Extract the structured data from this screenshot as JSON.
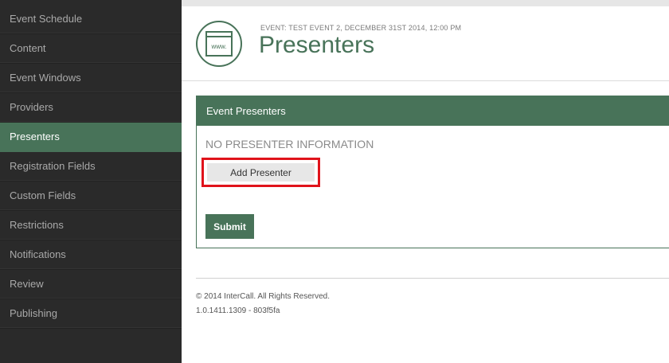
{
  "sidebar": {
    "items": [
      {
        "label": "Event Schedule"
      },
      {
        "label": "Content"
      },
      {
        "label": "Event Windows"
      },
      {
        "label": "Providers"
      },
      {
        "label": "Presenters",
        "active": true
      },
      {
        "label": "Registration Fields"
      },
      {
        "label": "Custom Fields"
      },
      {
        "label": "Restrictions"
      },
      {
        "label": "Notifications"
      },
      {
        "label": "Review"
      },
      {
        "label": "Publishing"
      }
    ]
  },
  "header": {
    "icon": "browser-window-icon",
    "icon_text": "www.",
    "event_line": "EVENT: TEST EVENT 2, DECEMBER 31ST 2014, 12:00 PM",
    "title": "Presenters"
  },
  "panel": {
    "title": "Event Presenters",
    "empty_message": "NO PRESENTER INFORMATION",
    "add_button": "Add Presenter",
    "submit_button": "Submit"
  },
  "footer": {
    "copyright": "© 2014 InterCall. All Rights Reserved.",
    "version": "1.0.1411.1309 - 803f5fa"
  },
  "colors": {
    "accent": "#487359",
    "sidebar_bg": "#2a2a2a",
    "highlight_border": "#e0131b"
  }
}
